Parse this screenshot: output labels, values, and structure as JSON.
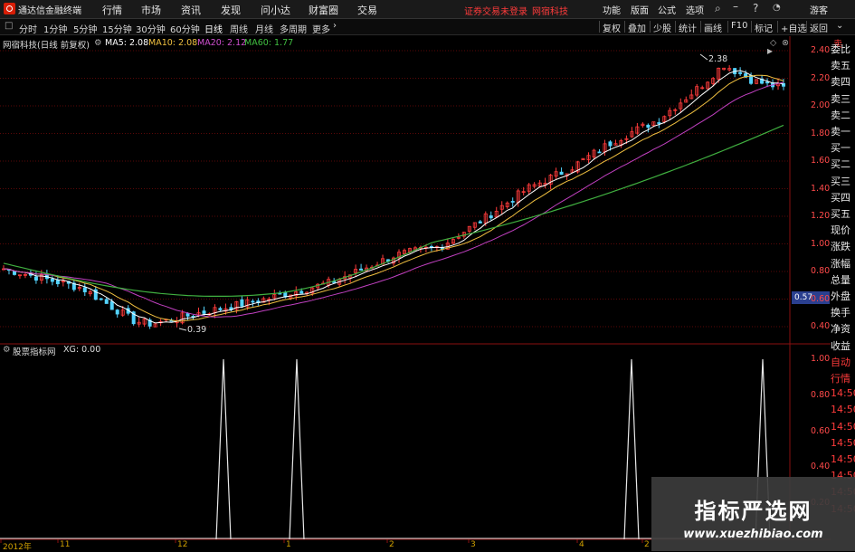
{
  "app": {
    "title": "通达信金融终端"
  },
  "menu": [
    "行情",
    "市场",
    "资讯",
    "发现",
    "问小达",
    "财富圈",
    "交易"
  ],
  "notice": "证券交易未登录",
  "stock_title": "网宿科技",
  "top_right": [
    "功能",
    "版面",
    "公式",
    "选项"
  ],
  "guest": "游客",
  "periods": [
    "分时",
    "1分钟",
    "5分钟",
    "15分钟",
    "30分钟",
    "60分钟",
    "日线",
    "周线",
    "月线",
    "多周期",
    "更多"
  ],
  "right_buttons": [
    "复权",
    "叠加",
    "少股",
    "统计",
    "画线",
    "F10",
    "标记",
    "+自选",
    "返回"
  ],
  "main_legend": {
    "name": "网宿科技(日线 前复权)",
    "ma5": "MA5: 2.08",
    "ma10": "MA10: 2.08",
    "ma20": "MA20: 2.12",
    "ma60": "MA60: 1.77"
  },
  "sub_legend": {
    "name": "股票指标网",
    "xg": "XG: 0.00"
  },
  "price_axis": [
    "2.40",
    "2.20",
    "2.00",
    "1.80",
    "1.60",
    "1.40",
    "1.20",
    "1.00",
    "0.80",
    "0.60",
    "0.40"
  ],
  "sub_axis": [
    "1.00",
    "0.80",
    "0.60",
    "0.40",
    "0.20"
  ],
  "current_price_tag": "0.57",
  "high_label": "2.38",
  "low_label": "0.39",
  "dates": [
    "2012年",
    "11",
    "12",
    "1",
    "2",
    "3",
    "4",
    "2"
  ],
  "side_panel": [
    "委比",
    "卖五",
    "卖四",
    "卖三",
    "卖二",
    "卖一",
    "买一",
    "买二",
    "买三",
    "买四",
    "买五",
    "现价",
    "涨跌",
    "涨幅",
    "总量",
    "外盘",
    "换手",
    "净资",
    "收益",
    "自动",
    "行情",
    "14:50",
    "14:50",
    "14:50",
    "14:50",
    "14:50",
    "14:50",
    "14:50",
    "14:50"
  ],
  "side_header": "卖",
  "watermark": {
    "title": "指标严选网",
    "url": "www.xuezhibiao.com"
  },
  "colors": {
    "ma5": "#ffffff",
    "ma10": "#f0c040",
    "ma20": "#c040c0",
    "ma60": "#40b040",
    "up": "#ff3b3b",
    "down": "#54d4ff",
    "grid": "#7a1010",
    "axis_text": "#ff4a4a"
  }
}
